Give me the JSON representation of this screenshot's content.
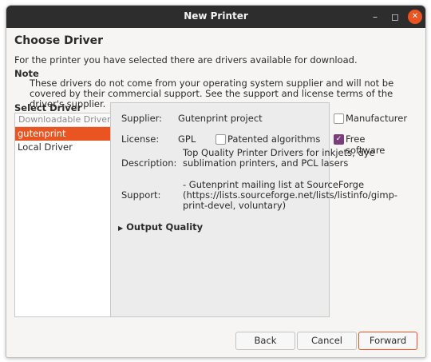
{
  "window": {
    "title": "New Printer"
  },
  "page": {
    "heading": "Choose Driver",
    "intro": "For the printer you have selected there are drivers available for download.",
    "note_label": "Note",
    "note_text": "These drivers do not come from your operating system supplier and will not be covered by their commercial support.  See the support and license terms of the driver's supplier."
  },
  "driver_list": {
    "label": "Select Driver",
    "header": "Downloadable Drivers",
    "items": [
      {
        "label": "gutenprint",
        "selected": true
      },
      {
        "label": "Local Driver",
        "selected": false
      }
    ]
  },
  "details": {
    "supplier_label": "Supplier:",
    "supplier_value": "Gutenprint project",
    "manufacturer_label": "Manufacturer",
    "manufacturer_checked": false,
    "license_label": "License:",
    "license_value": "GPL",
    "patented_label": "Patented algorithms",
    "patented_checked": false,
    "free_label": "Free software",
    "free_checked": true,
    "description_label": "Description:",
    "description_value": "Top Quality Printer Drivers for inkjets, dye sublimation printers, and PCL lasers",
    "support_label": "Support:",
    "support_value": " - Gutenprint mailing list at SourceForge (https://lists.sourceforge.net/lists/listinfo/gimp-print-devel, voluntary)",
    "output_quality_label": "Output Quality"
  },
  "buttons": {
    "back": "Back",
    "cancel": "Cancel",
    "forward": "Forward"
  },
  "colors": {
    "accent": "#e95420",
    "checkbox": "#7a3e7a",
    "titlebar": "#2d2d2d"
  }
}
